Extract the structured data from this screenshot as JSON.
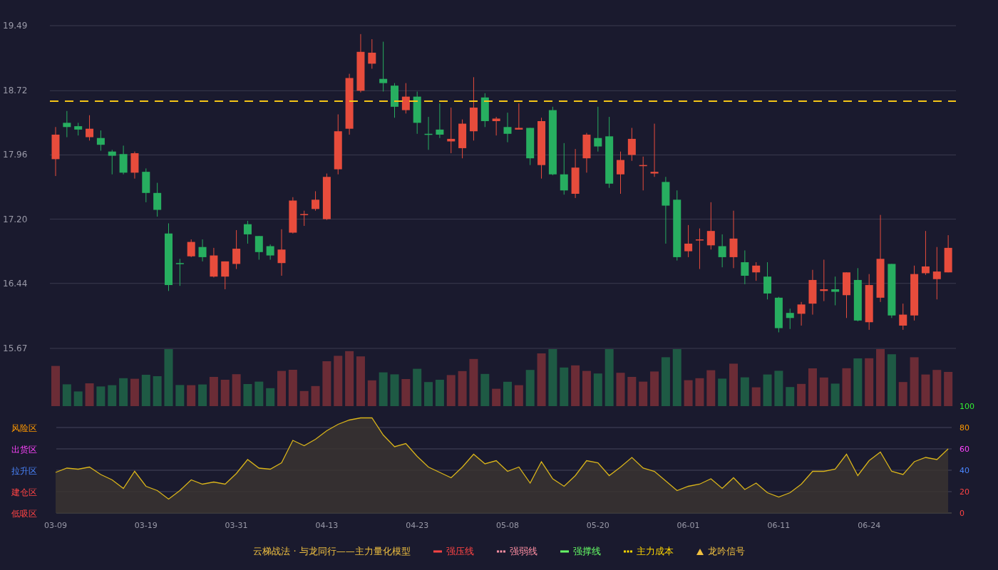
{
  "price_chart": {
    "chart_data": {
      "type": "candlestick",
      "grid": true,
      "ylim": [
        15.67,
        19.49
      ],
      "yticks": [
        {
          "value": 19.49,
          "label": "19.49"
        },
        {
          "value": 18.72,
          "label": "18.72"
        },
        {
          "value": 17.96,
          "label": "17.96"
        },
        {
          "value": 17.2,
          "label": "17.20"
        },
        {
          "value": 16.44,
          "label": "16.44"
        },
        {
          "value": 15.67,
          "label": "15.67"
        }
      ],
      "categories": [
        null,
        null,
        null,
        null,
        null,
        null,
        null,
        null,
        null,
        null,
        null,
        null,
        null,
        null,
        null,
        null,
        null,
        null,
        null,
        null,
        null,
        null,
        null,
        null,
        null,
        null,
        null,
        null,
        null,
        null,
        null,
        null,
        null,
        null,
        null,
        null,
        null,
        null,
        null,
        null,
        null,
        null,
        null,
        null,
        null,
        null,
        null,
        null,
        null,
        null,
        null,
        null,
        null,
        null,
        null,
        null,
        null,
        null,
        null,
        null,
        null,
        null,
        null,
        null,
        null,
        null,
        null,
        null,
        null,
        null,
        null,
        null,
        null,
        null,
        null,
        null,
        null,
        null,
        null,
        null
      ],
      "ohlc": [
        [
          17.91,
          18.29,
          17.71,
          18.2
        ],
        [
          18.34,
          18.48,
          18.17,
          18.29
        ],
        [
          18.3,
          18.34,
          18.19,
          18.26
        ],
        [
          18.17,
          18.43,
          18.13,
          18.27
        ],
        [
          18.16,
          18.25,
          18.01,
          18.08
        ],
        [
          18.0,
          18.02,
          17.73,
          17.95
        ],
        [
          17.97,
          18.07,
          17.73,
          17.75
        ],
        [
          17.75,
          18.0,
          17.68,
          17.98
        ],
        [
          17.76,
          17.8,
          17.4,
          17.51
        ],
        [
          17.51,
          17.63,
          17.23,
          17.31
        ],
        [
          17.03,
          17.15,
          16.35,
          16.42
        ],
        [
          16.68,
          16.73,
          16.41,
          16.67
        ],
        [
          16.76,
          16.96,
          16.75,
          16.93
        ],
        [
          16.87,
          16.96,
          16.7,
          16.75
        ],
        [
          16.52,
          16.86,
          16.51,
          16.77
        ],
        [
          16.52,
          16.7,
          16.37,
          16.7
        ],
        [
          16.67,
          17.07,
          16.61,
          16.85
        ],
        [
          17.14,
          17.18,
          16.91,
          17.02
        ],
        [
          17.0,
          17.0,
          16.72,
          16.81
        ],
        [
          16.88,
          16.9,
          16.72,
          16.77
        ],
        [
          16.68,
          17.08,
          16.53,
          16.84
        ],
        [
          17.04,
          17.46,
          17.03,
          17.42
        ],
        [
          17.25,
          17.3,
          17.12,
          17.26
        ],
        [
          17.32,
          17.53,
          17.3,
          17.43
        ],
        [
          17.2,
          17.74,
          17.19,
          17.7
        ],
        [
          17.79,
          18.44,
          17.73,
          18.24
        ],
        [
          18.27,
          18.92,
          18.2,
          18.87
        ],
        [
          18.72,
          19.39,
          18.7,
          19.18
        ],
        [
          19.04,
          19.33,
          18.98,
          19.17
        ],
        [
          18.86,
          19.3,
          18.71,
          18.81
        ],
        [
          18.78,
          18.81,
          18.4,
          18.53
        ],
        [
          18.49,
          18.81,
          18.45,
          18.65
        ],
        [
          18.65,
          18.71,
          18.21,
          18.34
        ],
        [
          18.21,
          18.41,
          18.02,
          18.2
        ],
        [
          18.26,
          18.57,
          18.16,
          18.2
        ],
        [
          18.12,
          18.52,
          17.98,
          18.15
        ],
        [
          18.04,
          18.38,
          17.92,
          18.33
        ],
        [
          18.24,
          18.88,
          18.13,
          18.52
        ],
        [
          18.64,
          18.69,
          18.29,
          18.36
        ],
        [
          18.36,
          18.41,
          18.19,
          18.39
        ],
        [
          18.29,
          18.46,
          18.11,
          18.21
        ],
        [
          18.26,
          18.57,
          18.26,
          18.28
        ],
        [
          18.28,
          18.28,
          17.84,
          17.92
        ],
        [
          17.84,
          18.4,
          17.68,
          18.36
        ],
        [
          18.49,
          18.53,
          17.72,
          17.73
        ],
        [
          17.73,
          18.1,
          17.49,
          17.54
        ],
        [
          17.5,
          18.03,
          17.45,
          17.81
        ],
        [
          17.92,
          18.22,
          17.75,
          18.2
        ],
        [
          18.16,
          18.53,
          18.0,
          18.06
        ],
        [
          18.18,
          18.41,
          17.57,
          17.62
        ],
        [
          17.73,
          18.0,
          17.5,
          17.9
        ],
        [
          17.96,
          18.28,
          17.89,
          18.15
        ],
        [
          17.83,
          17.94,
          17.54,
          17.84
        ],
        [
          17.74,
          18.33,
          17.7,
          17.76
        ],
        [
          17.64,
          17.7,
          16.91,
          17.36
        ],
        [
          17.43,
          17.54,
          16.71,
          16.75
        ],
        [
          16.82,
          17.13,
          16.75,
          16.91
        ],
        [
          16.95,
          17.09,
          16.61,
          16.96
        ],
        [
          16.89,
          17.4,
          16.84,
          17.06
        ],
        [
          16.88,
          17.02,
          16.63,
          16.75
        ],
        [
          16.75,
          17.3,
          16.62,
          16.97
        ],
        [
          16.69,
          16.83,
          16.43,
          16.53
        ],
        [
          16.57,
          16.69,
          16.47,
          16.65
        ],
        [
          16.52,
          16.69,
          16.25,
          16.32
        ],
        [
          16.27,
          16.28,
          15.86,
          15.91
        ],
        [
          16.09,
          16.14,
          15.9,
          16.03
        ],
        [
          16.08,
          16.22,
          15.94,
          16.19
        ],
        [
          16.2,
          16.6,
          16.07,
          16.48
        ],
        [
          16.35,
          16.72,
          16.23,
          16.37
        ],
        [
          16.37,
          16.52,
          16.18,
          16.34
        ],
        [
          16.3,
          16.57,
          16.03,
          16.57
        ],
        [
          16.48,
          16.62,
          15.99,
          16.0
        ],
        [
          15.98,
          16.55,
          15.89,
          16.42
        ],
        [
          16.27,
          17.25,
          16.22,
          16.73
        ],
        [
          16.67,
          16.67,
          16.03,
          16.06
        ],
        [
          15.94,
          16.2,
          15.89,
          16.07
        ],
        [
          16.06,
          16.65,
          16.0,
          16.55
        ],
        [
          16.56,
          17.06,
          16.54,
          16.64
        ],
        [
          16.49,
          16.87,
          16.25,
          16.58
        ],
        [
          16.57,
          17.01,
          16.57,
          16.86
        ]
      ],
      "orientation": "vertical"
    },
    "cost_line": {
      "color": "#f5c518"
    }
  },
  "oscillator": {
    "levels": [
      {
        "tick": "100",
        "color": "#33ee33"
      },
      {
        "zone": "风险区",
        "tick": "80",
        "color": "#ff9900"
      },
      {
        "zone": "出货区",
        "tick": "60",
        "color": "#ff44ff"
      },
      {
        "zone": "拉升区",
        "tick": "40",
        "color": "#4a86ff"
      },
      {
        "zone": "建仓区",
        "tick": "20",
        "color": "#ff4444"
      },
      {
        "zone": "低吸区",
        "tick": "0",
        "color": "#ff4444"
      }
    ],
    "chart_data": {
      "type": "area",
      "grid": true,
      "ylim": [
        0,
        100
      ],
      "yticks": [
        100,
        80,
        60,
        40,
        20,
        0
      ],
      "categories": [
        "03-09",
        null,
        null,
        null,
        null,
        null,
        null,
        null,
        "03-19",
        null,
        null,
        null,
        null,
        null,
        null,
        null,
        "03-31",
        null,
        null,
        null,
        null,
        null,
        null,
        null,
        "04-13",
        null,
        null,
        null,
        null,
        null,
        null,
        null,
        "04-23",
        null,
        null,
        null,
        null,
        null,
        null,
        null,
        "05-08",
        null,
        null,
        null,
        null,
        null,
        null,
        null,
        "05-20",
        null,
        null,
        null,
        null,
        null,
        null,
        null,
        "06-01",
        null,
        null,
        null,
        null,
        null,
        null,
        null,
        "06-11",
        null,
        null,
        null,
        null,
        null,
        null,
        null,
        "06-24",
        null,
        null,
        null,
        null,
        null,
        null,
        null
      ],
      "series": [
        {
          "color": "#d9b41a",
          "values": [
            38,
            42,
            41,
            43,
            36,
            31,
            23,
            39,
            25,
            21,
            13,
            21,
            31,
            27,
            29,
            27,
            37,
            50,
            42,
            41,
            47,
            68,
            63,
            69,
            77,
            83,
            87,
            89,
            89,
            73,
            62,
            65,
            53,
            43,
            38,
            33,
            43,
            55,
            46,
            49,
            39,
            43,
            28,
            48,
            32,
            25,
            35,
            49,
            47,
            35,
            43,
            52,
            42,
            39,
            30,
            21,
            25,
            27,
            32,
            23,
            33,
            22,
            28,
            19,
            15,
            19,
            27,
            39,
            39,
            41,
            55,
            35,
            49,
            57,
            39,
            36,
            48,
            52,
            50,
            60
          ]
        }
      ]
    }
  },
  "legend": {
    "title": "云梯战法 · 与龙同行——主力量化模型",
    "items": [
      {
        "kind": "solid",
        "label": "强压线",
        "color": "#ff4444"
      },
      {
        "kind": "dashed",
        "label": "强弱线",
        "color": "#ff8fa3"
      },
      {
        "kind": "solid",
        "label": "强撑线",
        "color": "#66ff66"
      },
      {
        "kind": "dashed",
        "label": "主力成本",
        "color": "#ffd700"
      },
      {
        "kind": "triangle",
        "label": "龙吟信号",
        "color": "#f0c040"
      }
    ]
  }
}
